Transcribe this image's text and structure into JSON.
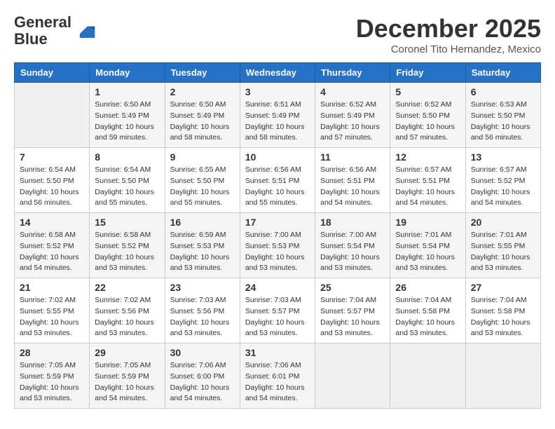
{
  "header": {
    "logo_general": "General",
    "logo_blue": "Blue",
    "month_title": "December 2025",
    "location": "Coronel Tito Hernandez, Mexico"
  },
  "weekdays": [
    "Sunday",
    "Monday",
    "Tuesday",
    "Wednesday",
    "Thursday",
    "Friday",
    "Saturday"
  ],
  "weeks": [
    [
      {
        "num": "",
        "empty": true
      },
      {
        "num": "1",
        "sunrise": "6:50 AM",
        "sunset": "5:49 PM",
        "daylight": "10 hours and 59 minutes."
      },
      {
        "num": "2",
        "sunrise": "6:50 AM",
        "sunset": "5:49 PM",
        "daylight": "10 hours and 58 minutes."
      },
      {
        "num": "3",
        "sunrise": "6:51 AM",
        "sunset": "5:49 PM",
        "daylight": "10 hours and 58 minutes."
      },
      {
        "num": "4",
        "sunrise": "6:52 AM",
        "sunset": "5:49 PM",
        "daylight": "10 hours and 57 minutes."
      },
      {
        "num": "5",
        "sunrise": "6:52 AM",
        "sunset": "5:50 PM",
        "daylight": "10 hours and 57 minutes."
      },
      {
        "num": "6",
        "sunrise": "6:53 AM",
        "sunset": "5:50 PM",
        "daylight": "10 hours and 56 minutes."
      }
    ],
    [
      {
        "num": "7",
        "sunrise": "6:54 AM",
        "sunset": "5:50 PM",
        "daylight": "10 hours and 56 minutes."
      },
      {
        "num": "8",
        "sunrise": "6:54 AM",
        "sunset": "5:50 PM",
        "daylight": "10 hours and 55 minutes."
      },
      {
        "num": "9",
        "sunrise": "6:55 AM",
        "sunset": "5:50 PM",
        "daylight": "10 hours and 55 minutes."
      },
      {
        "num": "10",
        "sunrise": "6:56 AM",
        "sunset": "5:51 PM",
        "daylight": "10 hours and 55 minutes."
      },
      {
        "num": "11",
        "sunrise": "6:56 AM",
        "sunset": "5:51 PM",
        "daylight": "10 hours and 54 minutes."
      },
      {
        "num": "12",
        "sunrise": "6:57 AM",
        "sunset": "5:51 PM",
        "daylight": "10 hours and 54 minutes."
      },
      {
        "num": "13",
        "sunrise": "6:57 AM",
        "sunset": "5:52 PM",
        "daylight": "10 hours and 54 minutes."
      }
    ],
    [
      {
        "num": "14",
        "sunrise": "6:58 AM",
        "sunset": "5:52 PM",
        "daylight": "10 hours and 54 minutes."
      },
      {
        "num": "15",
        "sunrise": "6:58 AM",
        "sunset": "5:52 PM",
        "daylight": "10 hours and 53 minutes."
      },
      {
        "num": "16",
        "sunrise": "6:59 AM",
        "sunset": "5:53 PM",
        "daylight": "10 hours and 53 minutes."
      },
      {
        "num": "17",
        "sunrise": "7:00 AM",
        "sunset": "5:53 PM",
        "daylight": "10 hours and 53 minutes."
      },
      {
        "num": "18",
        "sunrise": "7:00 AM",
        "sunset": "5:54 PM",
        "daylight": "10 hours and 53 minutes."
      },
      {
        "num": "19",
        "sunrise": "7:01 AM",
        "sunset": "5:54 PM",
        "daylight": "10 hours and 53 minutes."
      },
      {
        "num": "20",
        "sunrise": "7:01 AM",
        "sunset": "5:55 PM",
        "daylight": "10 hours and 53 minutes."
      }
    ],
    [
      {
        "num": "21",
        "sunrise": "7:02 AM",
        "sunset": "5:55 PM",
        "daylight": "10 hours and 53 minutes."
      },
      {
        "num": "22",
        "sunrise": "7:02 AM",
        "sunset": "5:56 PM",
        "daylight": "10 hours and 53 minutes."
      },
      {
        "num": "23",
        "sunrise": "7:03 AM",
        "sunset": "5:56 PM",
        "daylight": "10 hours and 53 minutes."
      },
      {
        "num": "24",
        "sunrise": "7:03 AM",
        "sunset": "5:57 PM",
        "daylight": "10 hours and 53 minutes."
      },
      {
        "num": "25",
        "sunrise": "7:04 AM",
        "sunset": "5:57 PM",
        "daylight": "10 hours and 53 minutes."
      },
      {
        "num": "26",
        "sunrise": "7:04 AM",
        "sunset": "5:58 PM",
        "daylight": "10 hours and 53 minutes."
      },
      {
        "num": "27",
        "sunrise": "7:04 AM",
        "sunset": "5:58 PM",
        "daylight": "10 hours and 53 minutes."
      }
    ],
    [
      {
        "num": "28",
        "sunrise": "7:05 AM",
        "sunset": "5:59 PM",
        "daylight": "10 hours and 53 minutes."
      },
      {
        "num": "29",
        "sunrise": "7:05 AM",
        "sunset": "5:59 PM",
        "daylight": "10 hours and 54 minutes."
      },
      {
        "num": "30",
        "sunrise": "7:06 AM",
        "sunset": "6:00 PM",
        "daylight": "10 hours and 54 minutes."
      },
      {
        "num": "31",
        "sunrise": "7:06 AM",
        "sunset": "6:01 PM",
        "daylight": "10 hours and 54 minutes."
      },
      {
        "num": "",
        "empty": true
      },
      {
        "num": "",
        "empty": true
      },
      {
        "num": "",
        "empty": true
      }
    ]
  ],
  "labels": {
    "sunrise": "Sunrise:",
    "sunset": "Sunset:",
    "daylight": "Daylight:"
  }
}
